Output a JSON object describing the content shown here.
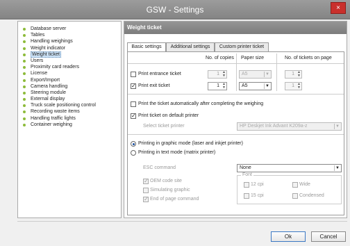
{
  "window": {
    "title": "GSW - Settings",
    "close_glyph": "×"
  },
  "nav": {
    "items": [
      {
        "label": "Database server"
      },
      {
        "label": "Tables"
      },
      {
        "label": "Handling weighings"
      },
      {
        "label": "Weight indicator"
      },
      {
        "label": "Weight ticket",
        "selected": true
      },
      {
        "label": "Users"
      },
      {
        "label": "Proximity card readers"
      },
      {
        "label": "License"
      },
      {
        "label": "Export/Import"
      },
      {
        "label": "Camera handling"
      },
      {
        "label": "Steering module"
      },
      {
        "label": "External display"
      },
      {
        "label": "Truck scale positioning control"
      },
      {
        "label": "Recording waste items"
      },
      {
        "label": "Handling traffic lights"
      },
      {
        "label": "Container weighing"
      }
    ]
  },
  "panel": {
    "title": "Weight ticket",
    "tabs": [
      {
        "label": "Basic settings",
        "active": true
      },
      {
        "label": "Additional settings"
      },
      {
        "label": "Custom printer ticket"
      }
    ],
    "basic": {
      "col_copies": "No. of copies",
      "col_paper": "Paper size",
      "col_tickets": "No. of tickets on page",
      "entrance_label": "Print entrance ticket",
      "entrance_checked": false,
      "entrance_copies": "1",
      "entrance_paper": "A5",
      "entrance_tickets": "1",
      "exit_label": "Print exit ticket",
      "exit_checked": true,
      "exit_copies": "1",
      "exit_paper": "A5",
      "exit_tickets": "1",
      "auto_label": "Print the ticket automatically after completing the weighing",
      "auto_checked": false,
      "default_printer_label": "Print ticket on default printer",
      "default_printer_checked": true,
      "select_printer_label": "Select ticket printer",
      "select_printer_value": "HP Deskjet Ink Advant K209a-z",
      "mode_graphic_label": "Printing in graphic mode (laser and inkjet printer)",
      "mode_text_label": "Printing in text mode (matrix printer)",
      "mode_selected": "graphic",
      "esc_label": "ESC command",
      "esc_value": "None",
      "oem_label": "OEM code site",
      "oem_checked": true,
      "simulating_label": "Simulating graphic",
      "simulating_checked": false,
      "endpage_label": "End of page command",
      "endpage_checked": true,
      "font_group_label": "Font",
      "cpi12_label": "12 cpi",
      "cpi15_label": "15 cpi",
      "wide_label": "Wide",
      "condensed_label": "Condensed"
    }
  },
  "footer": {
    "ok_label": "Ok",
    "cancel_label": "Cancel"
  },
  "icons": {
    "spin": "spin-arrows-icon",
    "dropdown": "chevron-down-icon"
  }
}
